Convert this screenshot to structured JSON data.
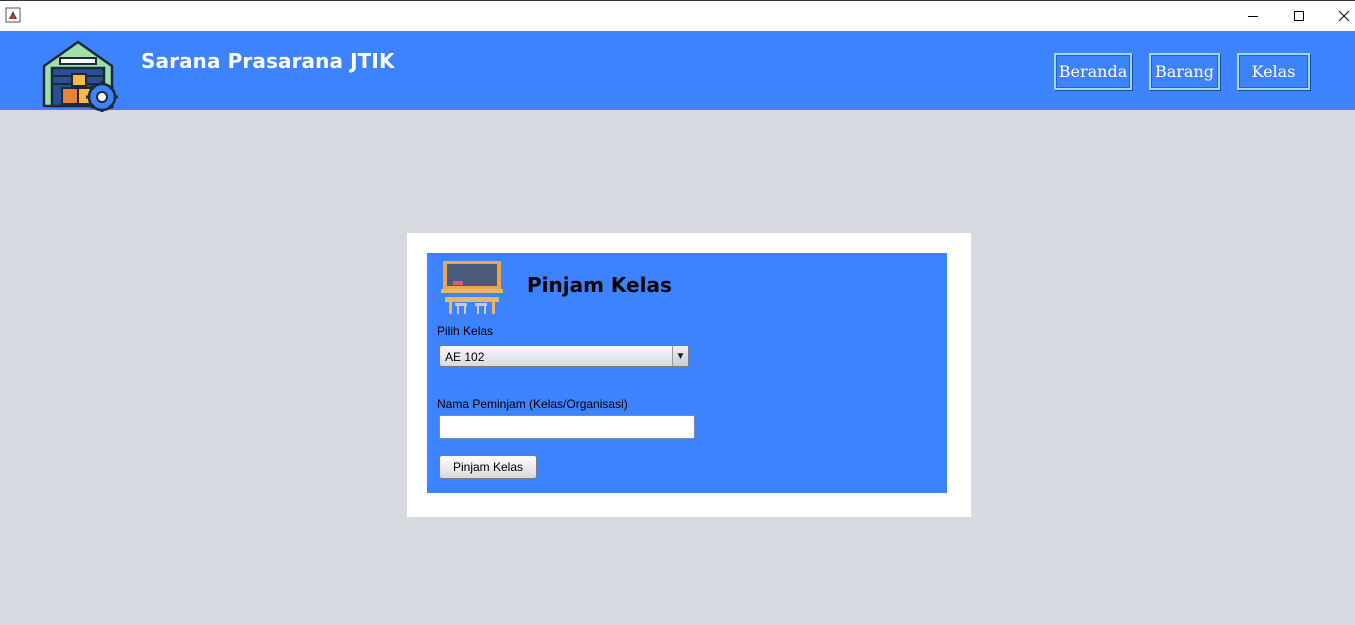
{
  "window": {
    "icon": "java-app-icon",
    "controls": {
      "minimize_icon": "minimize-icon",
      "maximize_icon": "maximize-icon",
      "close_icon": "close-icon"
    }
  },
  "header": {
    "logo_icon": "warehouse-gear-icon",
    "title": "Sarana Prasarana JTIK",
    "nav": [
      {
        "label": "Beranda"
      },
      {
        "label": "Barang"
      },
      {
        "label": "Kelas"
      }
    ]
  },
  "form": {
    "icon": "classroom-icon",
    "title": "Pinjam Kelas",
    "class_label": "Pilih Kelas",
    "class_selected": "AE 102",
    "borrower_label": "Nama Peminjam (Kelas/Organisasi)",
    "borrower_value": "",
    "submit_label": "Pinjam Kelas"
  },
  "colors": {
    "brand_blue": "#3d82ff",
    "background": "#d6d9e0",
    "card": "#ffffff"
  }
}
